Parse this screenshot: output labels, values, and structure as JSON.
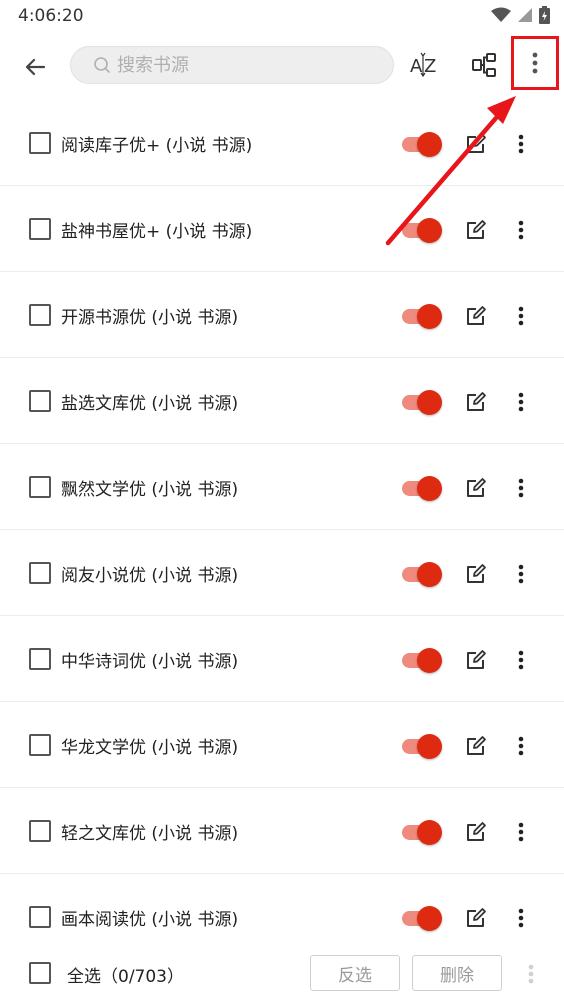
{
  "status_bar": {
    "time": "4:06:20"
  },
  "toolbar": {
    "search_placeholder": "搜索书源",
    "sort_icon": "sort-az-icon",
    "group_icon": "group-icon",
    "more_icon": "more-vertical-icon"
  },
  "sources": [
    {
      "name": "阅读库子优+ (小说 书源)",
      "enabled": true,
      "checked": false
    },
    {
      "name": "盐神书屋优+ (小说 书源)",
      "enabled": true,
      "checked": false
    },
    {
      "name": "开源书源优 (小说 书源)",
      "enabled": true,
      "checked": false
    },
    {
      "name": "盐选文库优 (小说 书源)",
      "enabled": true,
      "checked": false
    },
    {
      "name": "飘然文学优 (小说 书源)",
      "enabled": true,
      "checked": false
    },
    {
      "name": "阅友小说优 (小说 书源)",
      "enabled": true,
      "checked": false
    },
    {
      "name": "中华诗词优 (小说 书源)",
      "enabled": true,
      "checked": false
    },
    {
      "name": "华龙文学优 (小说 书源)",
      "enabled": true,
      "checked": false
    },
    {
      "name": "轻之文库优 (小说 书源)",
      "enabled": true,
      "checked": false
    },
    {
      "name": "画本阅读优 (小说 书源)",
      "enabled": true,
      "checked": false
    }
  ],
  "bottom_bar": {
    "select_all_label": "全选（0/703）",
    "invert_label": "反选",
    "delete_label": "删除"
  },
  "colors": {
    "accent": "#de2a10",
    "switch_track": "#ef8a7e",
    "annotation": "#e8151b"
  }
}
